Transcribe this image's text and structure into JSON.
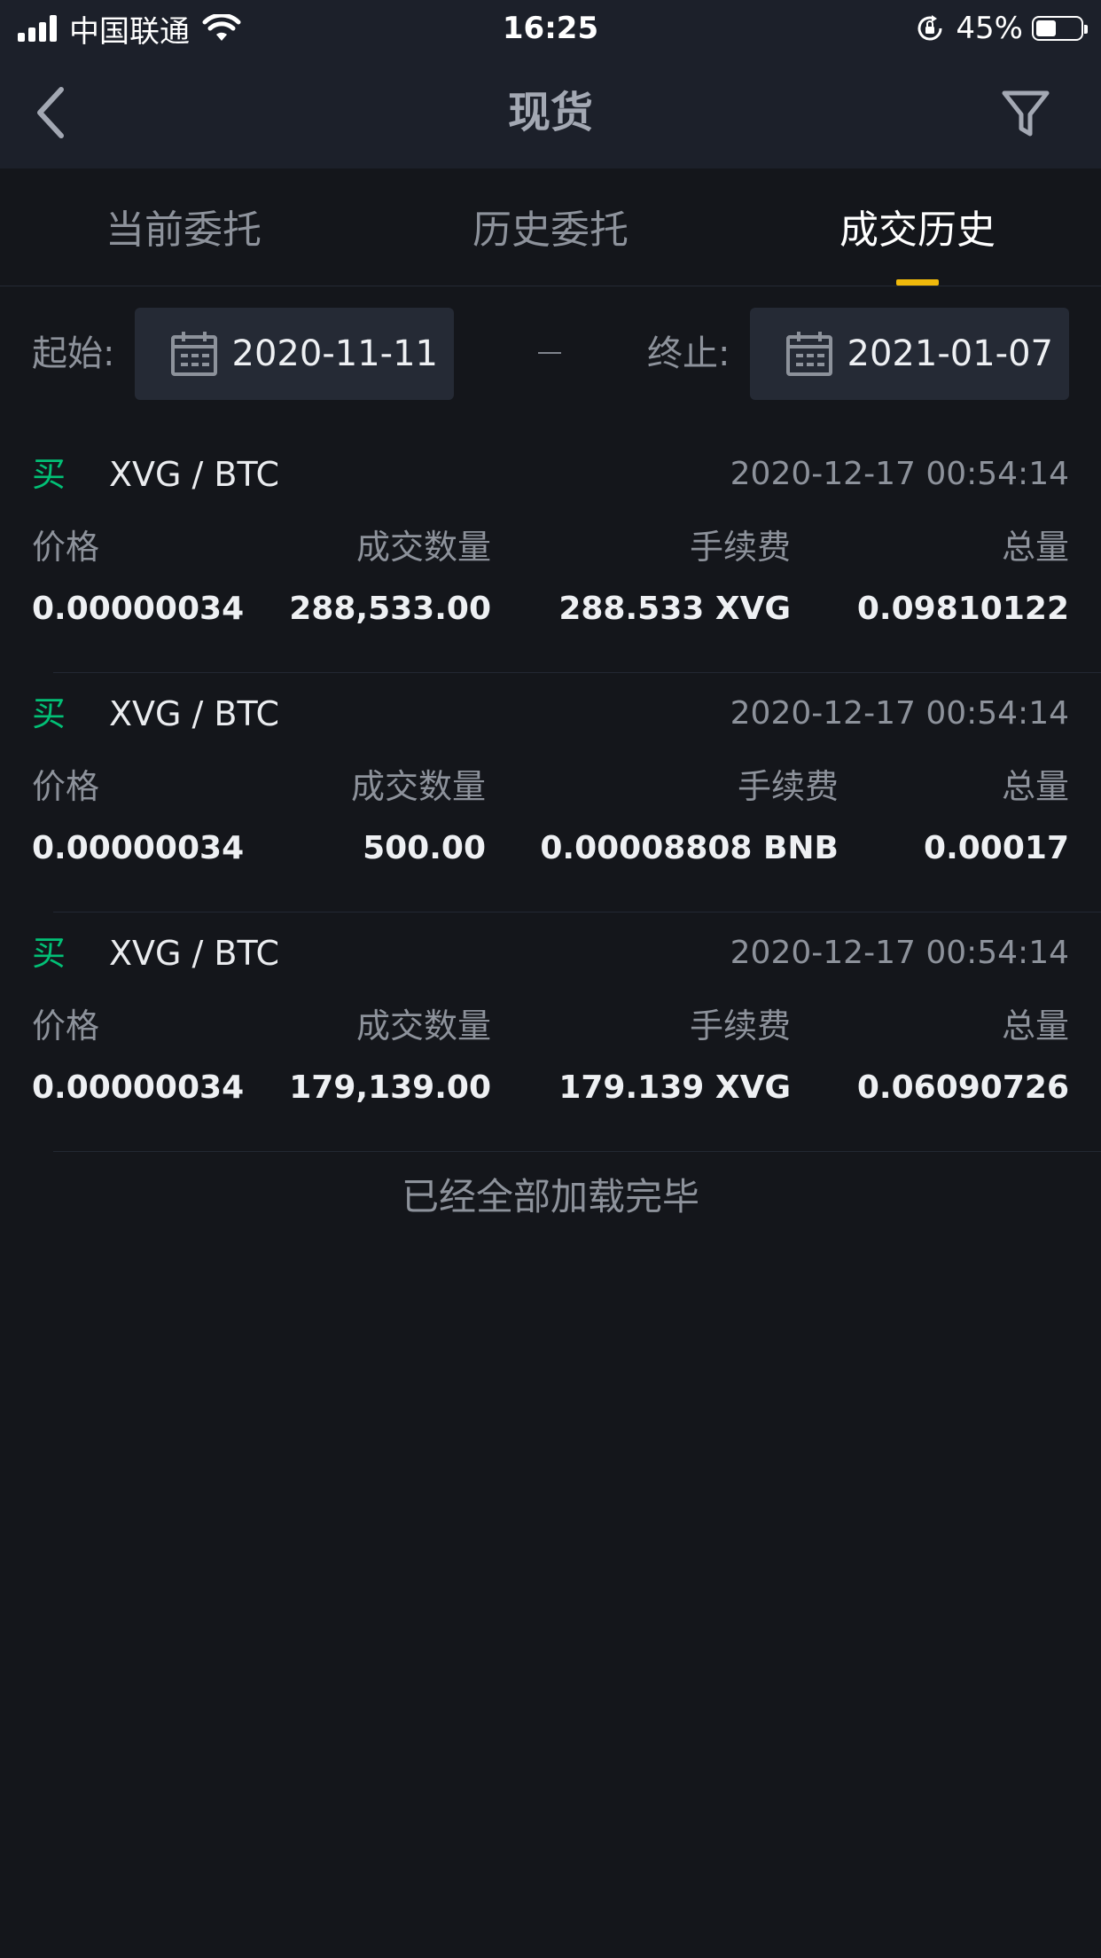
{
  "status_bar": {
    "carrier": "中国联通",
    "time": "16:25",
    "battery_percent": "45%",
    "battery_level": 0.45
  },
  "nav": {
    "title": "现货",
    "back_icon": "chevron-left-icon",
    "filter_icon": "filter-icon"
  },
  "tabs": [
    {
      "label": "当前委托",
      "active": false
    },
    {
      "label": "历史委托",
      "active": false
    },
    {
      "label": "成交历史",
      "active": true
    }
  ],
  "date_filter": {
    "start_label": "起始:",
    "start_date": "2020-11-11",
    "end_label": "终止:",
    "end_date": "2021-01-07"
  },
  "column_headers": {
    "price": "价格",
    "quantity": "成交数量",
    "fee": "手续费",
    "total": "总量"
  },
  "trades": [
    {
      "side": "买",
      "pair": "XVG / BTC",
      "time": "2020-12-17 00:54:14",
      "price": "0.00000034",
      "quantity": "288,533.00",
      "fee": "288.533 XVG",
      "total": "0.09810122"
    },
    {
      "side": "买",
      "pair": "XVG / BTC",
      "time": "2020-12-17 00:54:14",
      "price": "0.00000034",
      "quantity": "500.00",
      "fee": "0.00008808 BNB",
      "total": "0.00017"
    },
    {
      "side": "买",
      "pair": "XVG / BTC",
      "time": "2020-12-17 00:54:14",
      "price": "0.00000034",
      "quantity": "179,139.00",
      "fee": "179.139 XVG",
      "total": "0.06090726"
    }
  ],
  "footer": {
    "message": "已经全部加载完毕"
  },
  "colors": {
    "background": "#14161b",
    "header": "#1c202a",
    "buy": "#02c076",
    "accent": "#f0b90b",
    "muted_text": "#8d929b"
  }
}
